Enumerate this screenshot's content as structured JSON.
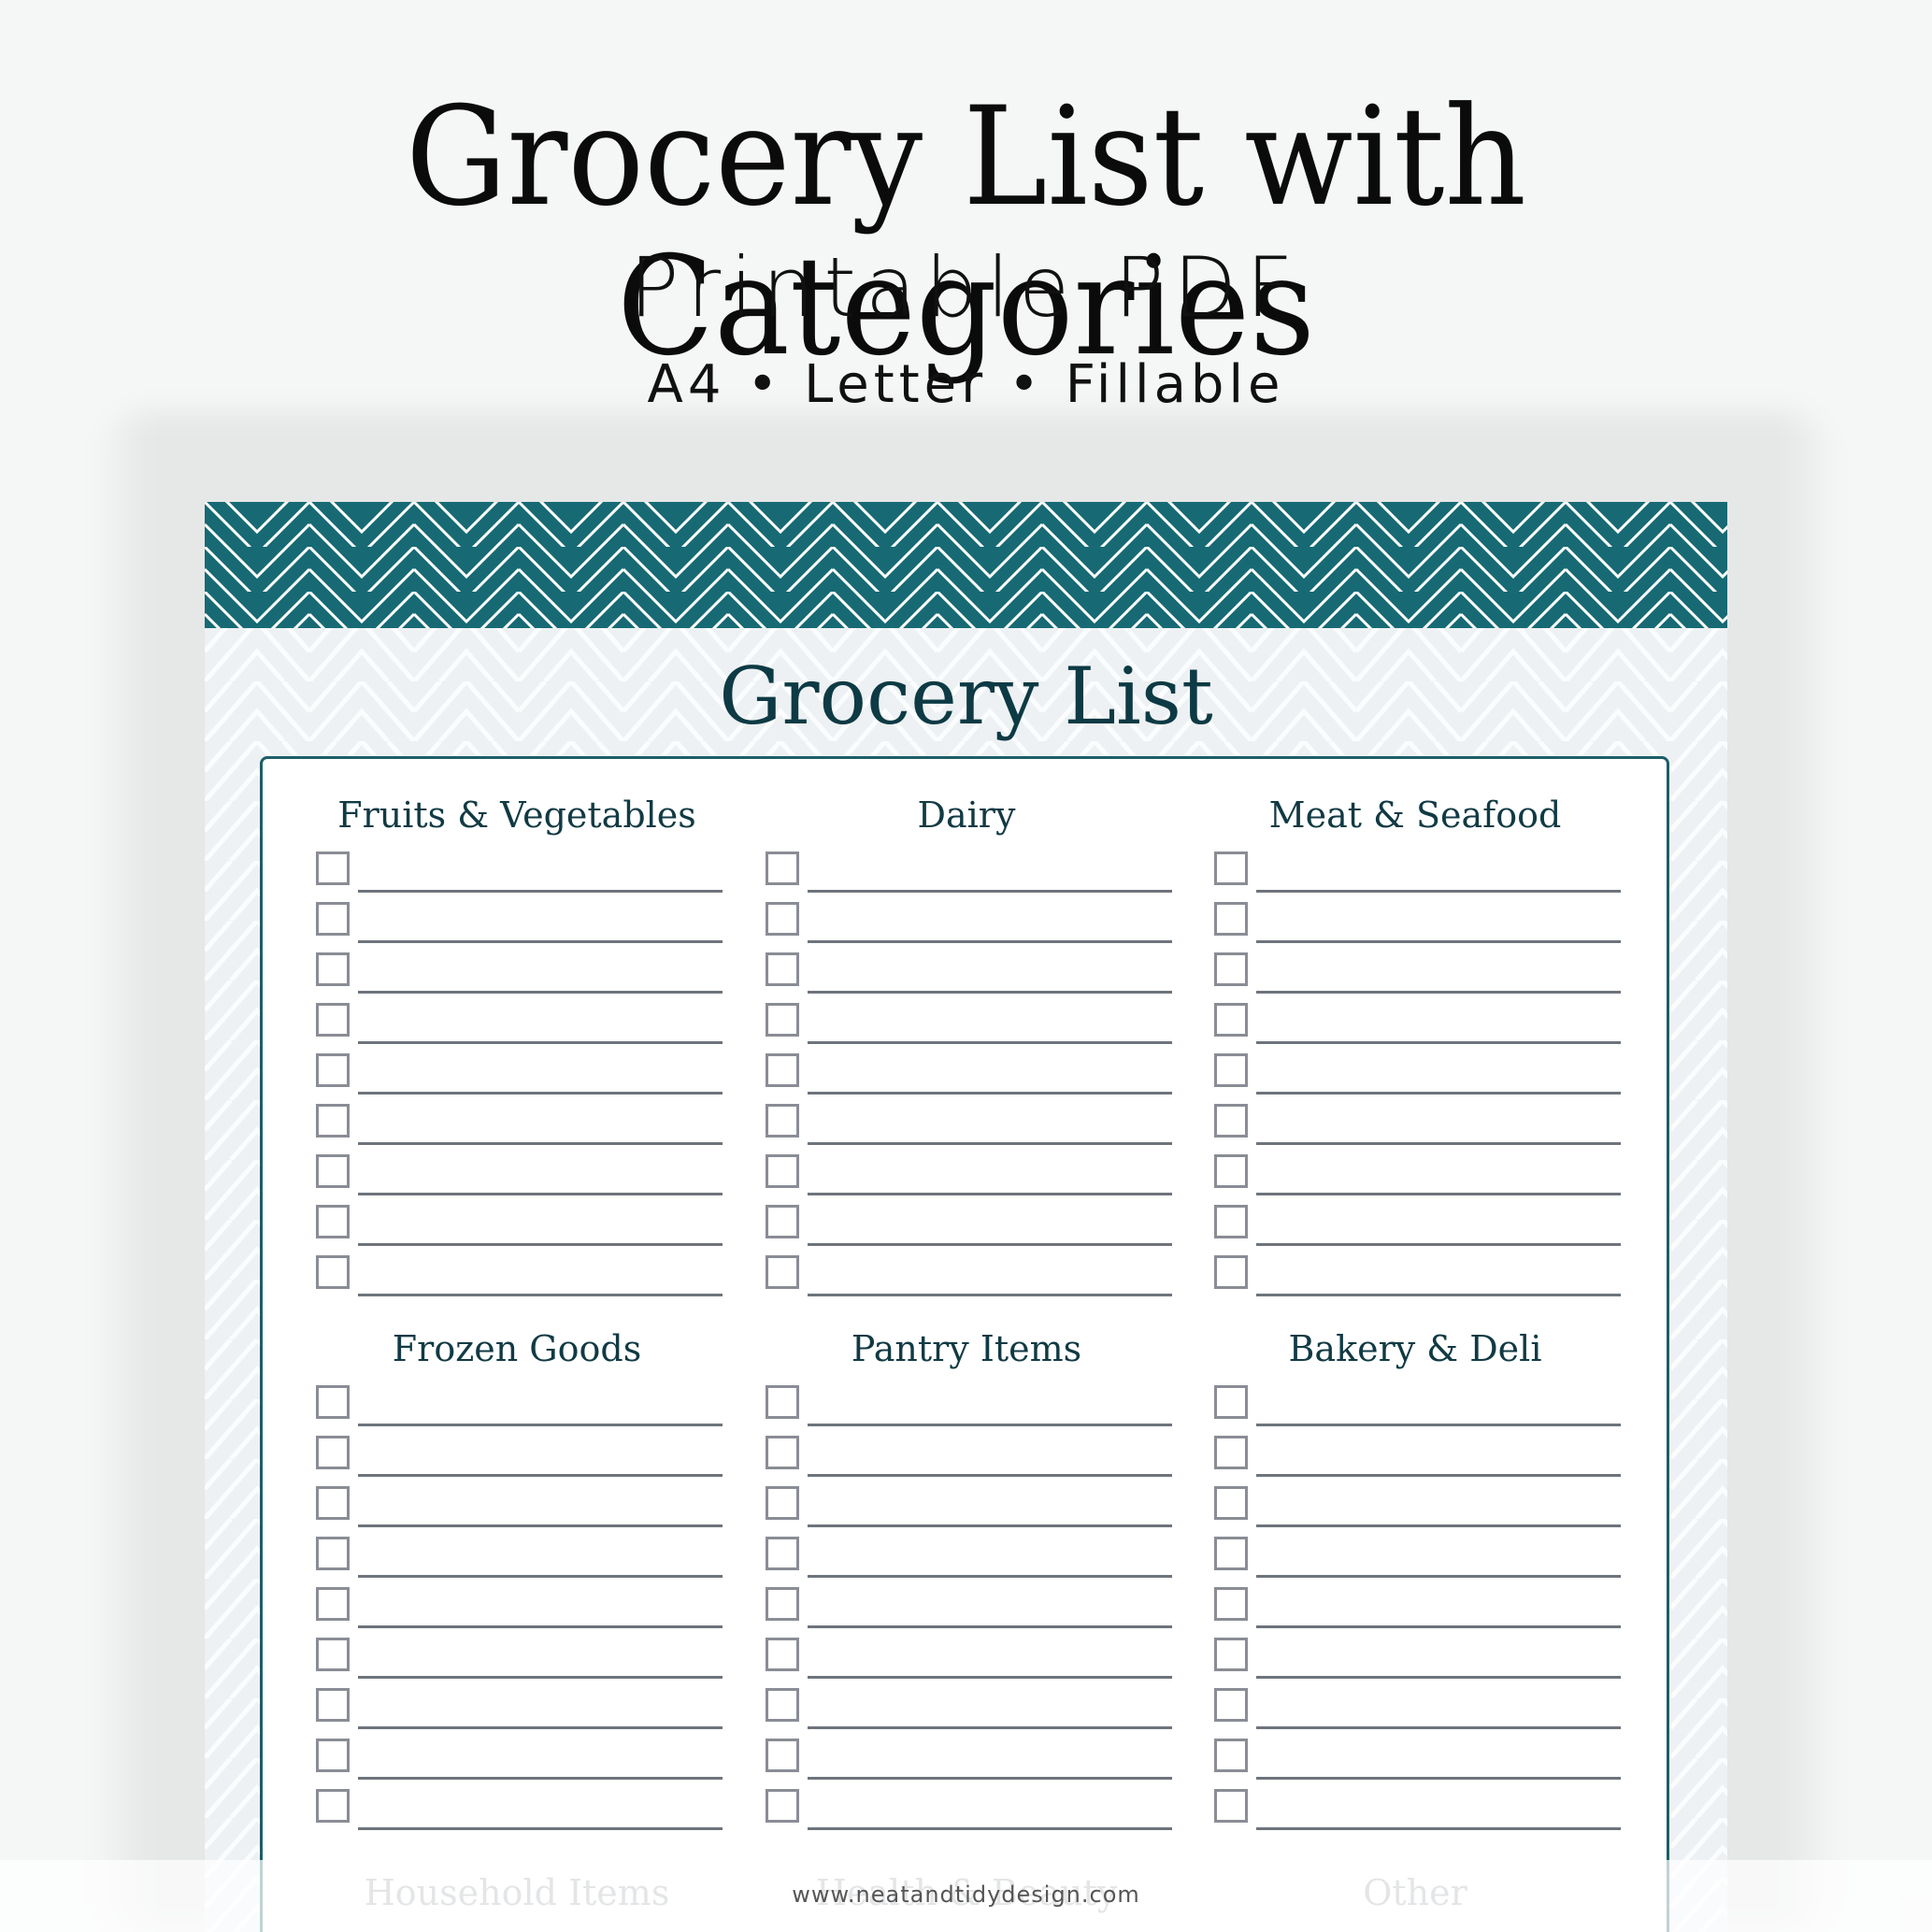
{
  "header": {
    "title": "Grocery List with Categories",
    "subtitle": "Printable PDF",
    "formats": "A4 • Letter • Fillable"
  },
  "sheet": {
    "title": "Grocery List",
    "accent_color": "#1a6670",
    "sections": [
      {
        "title": "Fruits & Vegetables",
        "rows": 9
      },
      {
        "title": "Dairy",
        "rows": 9
      },
      {
        "title": "Meat & Seafood",
        "rows": 9
      },
      {
        "title": "Frozen Goods",
        "rows": 9
      },
      {
        "title": "Pantry Items",
        "rows": 9
      },
      {
        "title": "Bakery & Deli",
        "rows": 9
      },
      {
        "title": "Household Items",
        "rows": 0
      },
      {
        "title": "Health & Beauty",
        "rows": 0
      },
      {
        "title": "Other",
        "rows": 0
      }
    ]
  },
  "watermark": "www.neatandtidydesign.com"
}
